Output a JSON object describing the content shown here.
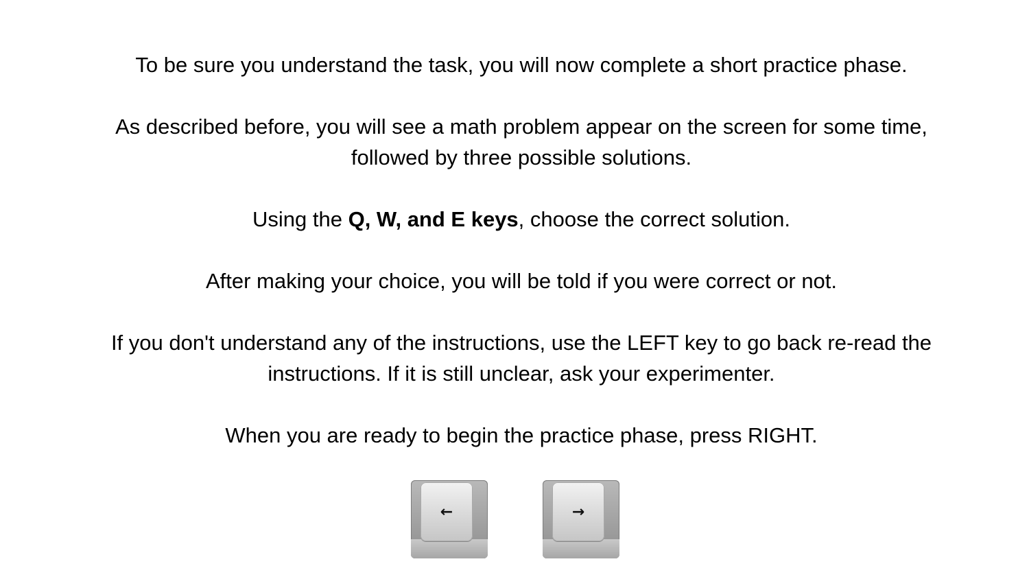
{
  "instructions": {
    "p1": "To be sure you understand the task, you will now complete a short practice phase.",
    "p2_line1": "As described before, you will see a math problem appear on the screen for some time,",
    "p2_line2": "followed by three possible solutions.",
    "p3_prefix": "Using the ",
    "p3_bold": "Q, W, and E keys",
    "p3_suffix": ", choose the correct solution.",
    "p4": "After making your choice, you will be told if you were correct or not.",
    "p5_line1": "If you don't understand any of the instructions, use the LEFT key to go back re-read the",
    "p5_line2": "instructions. If it is still unclear, ask your experimenter.",
    "p6": "When you are ready to begin the practice phase, press RIGHT."
  },
  "keys": {
    "left": {
      "glyph": "←",
      "icon": "left-arrow-icon"
    },
    "right": {
      "glyph": "→",
      "icon": "right-arrow-icon"
    }
  }
}
